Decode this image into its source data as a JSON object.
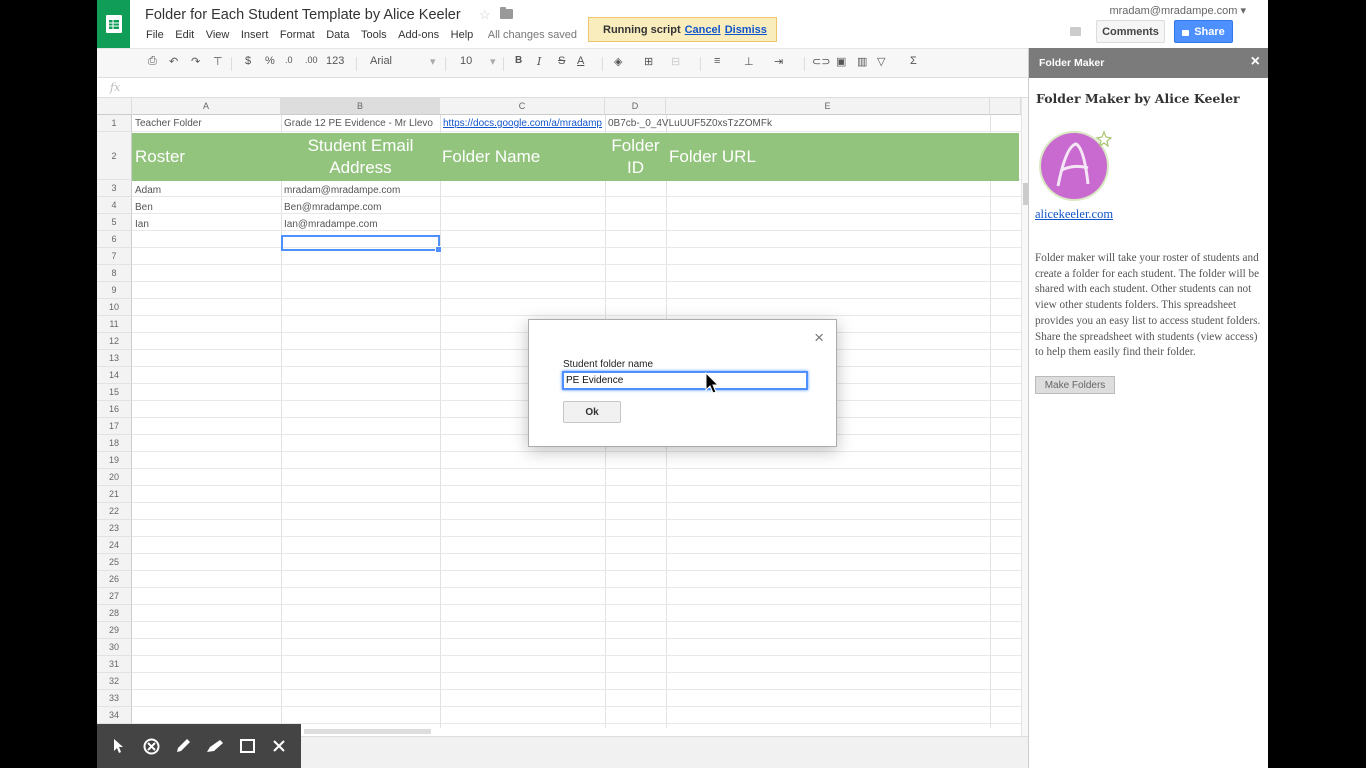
{
  "document": {
    "title": "Folder for Each Student Template by Alice Keeler",
    "save_status": "All changes saved"
  },
  "menu": [
    "File",
    "Edit",
    "View",
    "Insert",
    "Format",
    "Data",
    "Tools",
    "Add-ons",
    "Help"
  ],
  "notice": {
    "text": "Running script",
    "cancel": "Cancel",
    "dismiss": "Dismiss"
  },
  "user": {
    "email": "mradam@mradampe.com"
  },
  "buttons": {
    "comments": "Comments",
    "share": "Share"
  },
  "toolbar": {
    "currency": "$",
    "percent": "%",
    "dec_less": ".0",
    "dec_more": ".00",
    "format_more": "123",
    "font": "Arial",
    "font_size": "10",
    "bold": "B",
    "italic": "I",
    "strike": "S",
    "text_color": "A",
    "sum": "Σ"
  },
  "formula_bar": {
    "fx": "fx"
  },
  "grid": {
    "columns": [
      "A",
      "B",
      "C",
      "D",
      "E"
    ],
    "row_numbers": [
      "1",
      "2",
      "3",
      "4",
      "5",
      "6",
      "7",
      "8",
      "9",
      "10",
      "11",
      "12",
      "13",
      "14",
      "15",
      "16",
      "17",
      "18",
      "19",
      "20",
      "21",
      "22",
      "23",
      "24",
      "25",
      "26",
      "27",
      "28",
      "29",
      "30",
      "31",
      "32",
      "33",
      "34"
    ],
    "row1": {
      "a": "Teacher Folder",
      "b": "Grade 12 PE Evidence - Mr Llevo",
      "c": "https://docs.google.com/a/mradamp",
      "d": "0B7cb-_0_4VLuUUF5Z0xsTzZOMFk"
    },
    "headers": {
      "roster": "Roster",
      "email_line1": "Student Email",
      "email_line2": "Address",
      "folder_name": "Folder Name",
      "folder_id_line1": "Folder",
      "folder_id_line2": "ID",
      "folder_url": "Folder URL"
    },
    "students": [
      {
        "name": "Adam",
        "email": "mradam@mradampe.com"
      },
      {
        "name": "Ben",
        "email": "Ben@mradampe.com"
      },
      {
        "name": "Ian",
        "email": "Ian@mradampe.com"
      }
    ]
  },
  "dialog": {
    "label": "Student folder name",
    "value": "PE Evidence",
    "ok": "Ok",
    "close": "×"
  },
  "side_panel": {
    "title": "Folder Maker",
    "close": "×",
    "heading": "Folder Maker by Alice Keeler",
    "link": "alicekeeler.com",
    "description": "Folder maker will take your roster of students and create a folder for each student. The folder will be shared with each student. Other students can not view other students folders. This spreadsheet provides you an easy list to access student folders. Share the spreadsheet with students (view access) to help them easily find their folder.",
    "button": "Make Folders"
  },
  "colors": {
    "header_band": "#93c47d",
    "share": "#4d90fe",
    "sheets_green": "#0f9d58",
    "panel_header": "#7b7b7b"
  }
}
